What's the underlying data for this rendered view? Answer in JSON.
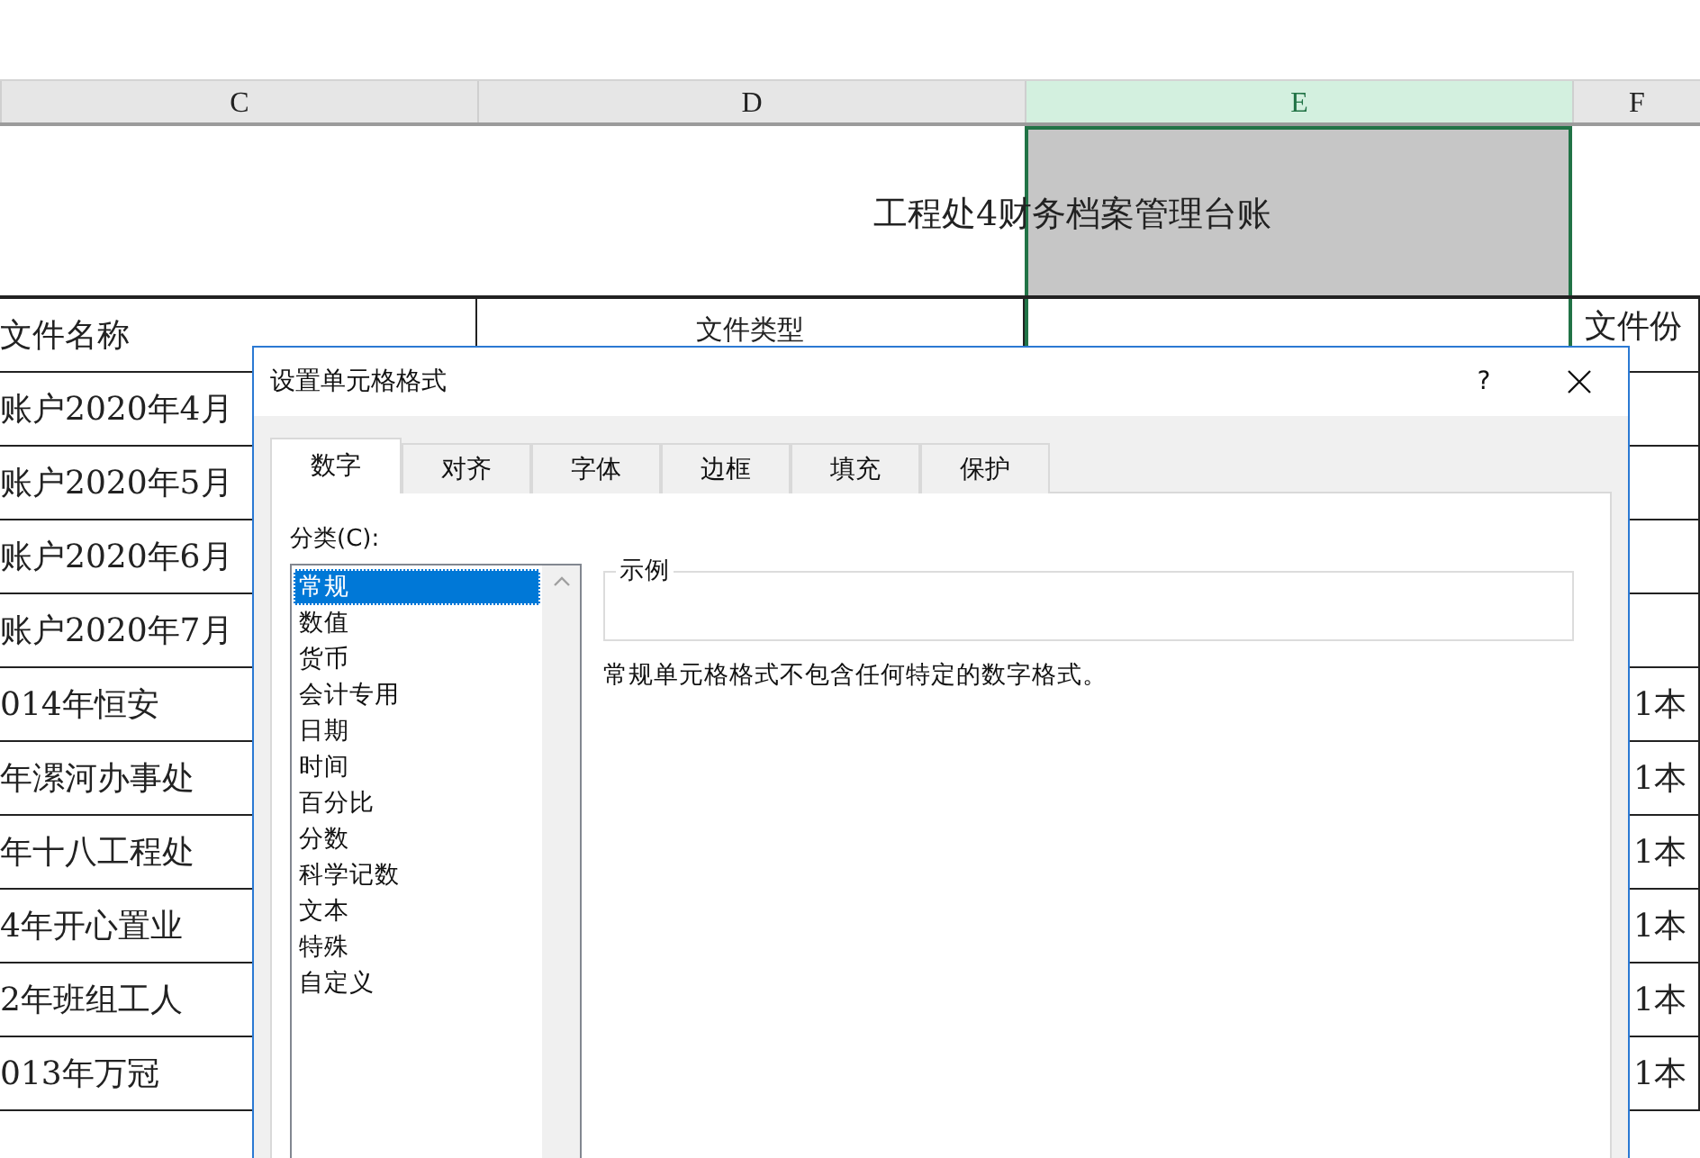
{
  "sheet": {
    "columns": [
      {
        "label": "C",
        "selected": false
      },
      {
        "label": "D",
        "selected": false
      },
      {
        "label": "E",
        "selected": true
      },
      {
        "label": "F",
        "selected": false
      }
    ],
    "title": "工程处4财务档案管理台账",
    "header": {
      "column_c": "文件名称",
      "column_d": "文件类型",
      "column_f": "文件份"
    },
    "rows": [
      {
        "name": "账户2020年4月"
      },
      {
        "name": "账户2020年5月"
      },
      {
        "name": "账户2020年6月"
      },
      {
        "name": "账户2020年7月"
      },
      {
        "name": "014年恒安",
        "count": "1本"
      },
      {
        "name": "年漯河办事处",
        "count": "1本"
      },
      {
        "name": "年十八工程处",
        "count": "1本"
      },
      {
        "name": "4年开心置业",
        "count": "1本"
      },
      {
        "name": "2年班组工人",
        "count": "1本"
      },
      {
        "name": "013年万冠",
        "count": "1本"
      }
    ]
  },
  "dialog": {
    "title": "设置单元格格式",
    "help": "?",
    "tabs": [
      {
        "label": "数字",
        "selected": true
      },
      {
        "label": "对齐",
        "selected": false
      },
      {
        "label": "字体",
        "selected": false
      },
      {
        "label": "边框",
        "selected": false
      },
      {
        "label": "填充",
        "selected": false
      },
      {
        "label": "保护",
        "selected": false
      }
    ],
    "category_label": "分类(C):",
    "categories": [
      {
        "label": "常规",
        "selected": true
      },
      {
        "label": "数值",
        "selected": false
      },
      {
        "label": "货币",
        "selected": false
      },
      {
        "label": "会计专用",
        "selected": false
      },
      {
        "label": "日期",
        "selected": false
      },
      {
        "label": "时间",
        "selected": false
      },
      {
        "label": "百分比",
        "selected": false
      },
      {
        "label": "分数",
        "selected": false
      },
      {
        "label": "科学记数",
        "selected": false
      },
      {
        "label": "文本",
        "selected": false
      },
      {
        "label": "特殊",
        "selected": false
      },
      {
        "label": "自定义",
        "selected": false
      }
    ],
    "sample_label": "示例",
    "description": "常规单元格格式不包含任何特定的数字格式。"
  }
}
